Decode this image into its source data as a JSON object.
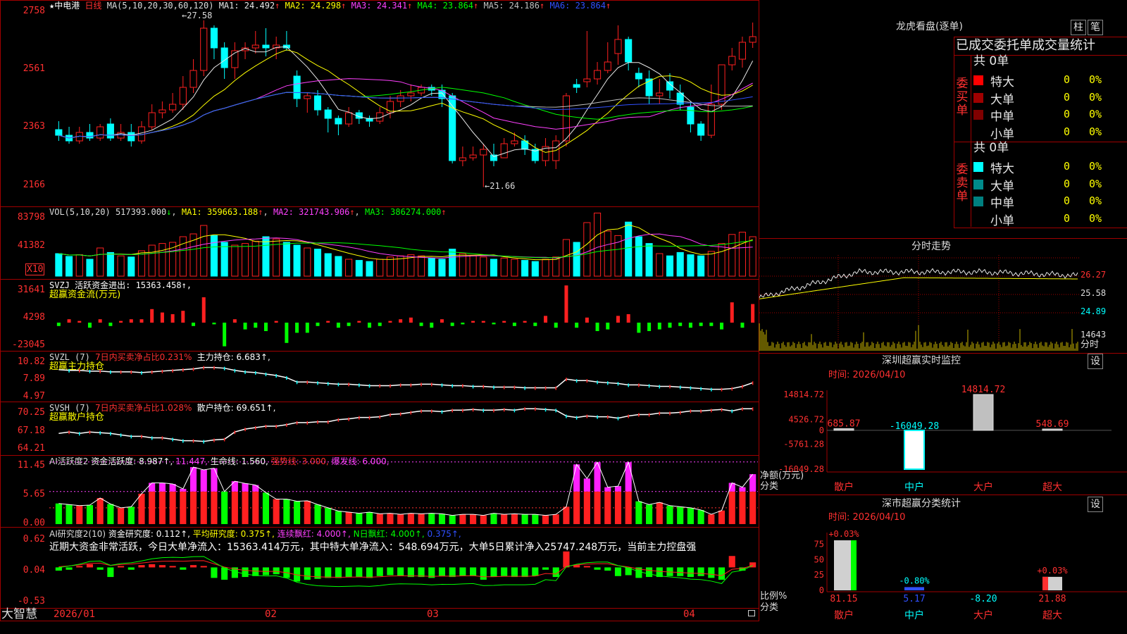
{
  "stock": {
    "star": "★",
    "name": "中电港",
    "period": "日线",
    "ma_title": "MA(5,10,20,30,60,120)",
    "ma": [
      {
        "label": "MA1: 24.492",
        "arrow": "↑",
        "color": "#e8e8e8"
      },
      {
        "label": "MA2: 24.298",
        "arrow": "↑",
        "color": "#ffff00"
      },
      {
        "label": "MA3: 24.341",
        "arrow": "↑",
        "color": "#ff40ff"
      },
      {
        "label": "MA4: 23.864",
        "arrow": "↑",
        "color": "#00ff00"
      },
      {
        "label": "MA5: 24.186",
        "arrow": "↑",
        "color": "#c0c0c0"
      },
      {
        "label": "MA6: 23.864",
        "arrow": "↑",
        "color": "#3050ff"
      }
    ],
    "high_mark": "←27.58",
    "low_mark": "←21.66"
  },
  "price_axis": [
    "2758",
    "2561",
    "2363",
    "2166"
  ],
  "vol": {
    "title": "VOL(5,10,20)",
    "value": "517393.000",
    "down": "↓",
    "ma1": "MA1: 359663.188",
    "ma2": "MA2: 321743.906",
    "ma3": "MA3: 386274.000",
    "up": "↑",
    "axis": [
      "83798",
      "41382"
    ],
    "unit": "X10"
  },
  "svzj": {
    "title": "SVZJ  活跃资金进出: 15363.458↑,",
    "subtitle": "超赢资金流(万元)",
    "axis": [
      "31641",
      "4298",
      "-23045"
    ]
  },
  "svzl": {
    "title": "SVZL (7)",
    "red": "7日内买卖净占比0.231%",
    "white": "主力持仓: 6.683↑,",
    "subtitle": "超赢主力持仓",
    "axis": [
      "10.82",
      "7.89",
      "4.97"
    ]
  },
  "svsh": {
    "title": "SVSH (7)",
    "red": "7日内买卖净占比1.028%",
    "white": "散户持仓: 69.651↑,",
    "subtitle": "超赢散户持仓",
    "axis": [
      "70.25",
      "67.18",
      "64.21"
    ]
  },
  "ai_act": {
    "title": "AI活跃度2",
    "a": "资金活跃度: 8.987↑,",
    "b": "11.447,",
    "c": "生命线: 1.560,",
    "d": "强势线: 3.000,",
    "e": "爆发线: 6.000,",
    "axis": [
      "11.45",
      "5.65",
      "0.00"
    ]
  },
  "ai_res": {
    "title": "AI研究度2(10)",
    "a": "资金研究度: 0.112↑,",
    "b": "平均研究度: 0.375↑,",
    "c": "连续飘红: 4.000↑,",
    "d": "N日飘红: 4.000↑,",
    "e": "0.375↑,",
    "note": "近期大资金非常活跃，今日大单净流入：15363.414万元，其中特大单净流入：548.694万元，大单5日累计净入25747.248万元，当前主力控盘强",
    "axis": [
      "0.62",
      "0.04",
      "-0.53"
    ]
  },
  "date_axis": [
    "2026/01",
    "02",
    "03",
    "04"
  ],
  "brand": "大智慧",
  "lhb": {
    "title": "龙虎看盘(逐单)",
    "btn1": "柱",
    "btn2": "笔",
    "tabs": "已成交委托单成交量统计",
    "buy_label": "委买单",
    "sell_label": "委卖单",
    "count": "共 0单",
    "rows": [
      {
        "name": "特大",
        "v": "0",
        "p": "0%"
      },
      {
        "name": "大单",
        "v": "0",
        "p": "0%"
      },
      {
        "name": "中单",
        "v": "0",
        "p": "0%"
      },
      {
        "name": "小单",
        "v": "0",
        "p": "0%"
      }
    ],
    "colors": {
      "buy": [
        "#ff0000",
        "#a00000",
        "#800000",
        "#000000"
      ],
      "sell": [
        "#00ffff",
        "#008b8b",
        "#008080",
        "#000000"
      ]
    }
  },
  "fenshi": {
    "title": "分时走势",
    "axis": [
      "26.27",
      "25.58",
      "24.89"
    ],
    "vol_label": "14643",
    "vol_unit": "分时"
  },
  "sz_rt": {
    "title": "深圳超赢实时监控",
    "btn": "设",
    "time": "时间: 2026/04/10",
    "axis": [
      "14814.72",
      "4526.72",
      "0",
      "-5761.28",
      "-16049.28"
    ],
    "ylabel": "净额(万元)",
    "xlabel": "分类",
    "cats": [
      "散户",
      "中户",
      "大户",
      "超大"
    ],
    "values": [
      685.87,
      -16049.28,
      14814.72,
      548.69
    ],
    "value_labels": [
      "685.87",
      "-16049.28",
      "14814.72",
      "548.69"
    ]
  },
  "sz_cls": {
    "title": "深市超赢分类统计",
    "btn": "设",
    "time": "时间: 2026/04/10",
    "axis": [
      "75",
      "50",
      "25",
      "0"
    ],
    "ylabel": "比例%",
    "xlabel": "分类",
    "cats": [
      "散户",
      "中户",
      "大户",
      "超大"
    ],
    "values": [
      81.15,
      5.17,
      -8.2,
      21.88
    ],
    "value_labels": [
      "81.15",
      "5.17",
      "-8.20",
      "21.88"
    ],
    "top_labels": [
      "+0.03%",
      "-0.80%",
      "",
      "+0.03%"
    ]
  },
  "chart_data": {
    "type": "candlestick",
    "candles": [
      [
        23.7,
        23.5,
        24.0,
        23.3
      ],
      [
        23.5,
        23.3,
        23.8,
        23.2
      ],
      [
        23.3,
        23.6,
        23.8,
        23.2
      ],
      [
        23.6,
        23.4,
        23.9,
        23.3
      ],
      [
        23.4,
        23.8,
        23.9,
        23.3
      ],
      [
        23.9,
        23.4,
        24.1,
        23.3
      ],
      [
        23.4,
        23.6,
        23.9,
        23.3
      ],
      [
        23.6,
        23.3,
        23.9,
        23.1
      ],
      [
        23.3,
        23.8,
        24.0,
        23.2
      ],
      [
        23.8,
        24.3,
        24.6,
        23.7
      ],
      [
        24.3,
        24.4,
        24.7,
        24.1
      ],
      [
        24.4,
        24.6,
        25.0,
        24.3
      ],
      [
        24.6,
        25.2,
        25.6,
        24.4
      ],
      [
        25.2,
        25.8,
        26.2,
        25.0
      ],
      [
        25.8,
        27.3,
        27.58,
        25.6
      ],
      [
        27.3,
        26.6,
        27.4,
        26.2
      ],
      [
        26.6,
        25.9,
        26.8,
        25.5
      ],
      [
        25.9,
        26.5,
        26.8,
        25.5
      ],
      [
        26.5,
        26.6,
        26.8,
        26.2
      ],
      [
        26.6,
        26.7,
        27.2,
        26.4
      ],
      [
        26.7,
        26.6,
        27.3,
        26.3
      ],
      [
        26.6,
        26.7,
        27.0,
        26.2
      ],
      [
        26.7,
        26.6,
        27.2,
        26.5
      ],
      [
        25.6,
        24.8,
        25.8,
        24.5
      ],
      [
        24.8,
        24.9,
        25.0,
        24.3
      ],
      [
        24.9,
        24.4,
        25.1,
        24.2
      ],
      [
        24.4,
        24.1,
        24.5,
        23.6
      ],
      [
        24.1,
        23.9,
        24.2,
        23.5
      ],
      [
        23.9,
        24.3,
        24.5,
        23.8
      ],
      [
        24.3,
        24.1,
        24.4,
        23.9
      ],
      [
        24.1,
        24.0,
        24.2,
        23.8
      ],
      [
        24.0,
        24.3,
        24.5,
        23.9
      ],
      [
        24.3,
        24.7,
        24.9,
        24.1
      ],
      [
        24.7,
        24.9,
        25.1,
        24.5
      ],
      [
        24.9,
        25.0,
        25.3,
        24.7
      ],
      [
        25.0,
        25.2,
        25.3,
        24.9
      ],
      [
        25.2,
        25.1,
        25.3,
        24.9
      ],
      [
        25.1,
        24.8,
        25.3,
        24.5
      ],
      [
        24.9,
        22.6,
        25.0,
        22.5
      ],
      [
        22.6,
        22.7,
        23.1,
        22.4
      ],
      [
        22.7,
        22.8,
        23.1,
        22.6
      ],
      [
        22.8,
        23.0,
        23.2,
        21.66
      ],
      [
        22.8,
        22.6,
        23.2,
        22.4
      ],
      [
        22.7,
        23.2,
        23.4,
        22.8
      ],
      [
        23.2,
        23.3,
        23.6,
        23.1
      ],
      [
        23.3,
        23.0,
        23.5,
        22.8
      ],
      [
        23.0,
        22.6,
        23.2,
        22.5
      ],
      [
        22.6,
        23.1,
        23.4,
        22.4
      ],
      [
        22.6,
        23.3,
        23.5,
        22.3
      ],
      [
        23.3,
        24.9,
        25.0,
        23.1
      ],
      [
        25.3,
        25.2,
        25.5,
        25.0
      ],
      [
        25.4,
        25.5,
        27.2,
        25.2
      ],
      [
        25.5,
        25.8,
        26.1,
        25.3
      ],
      [
        25.8,
        26.1,
        26.8,
        25.7
      ],
      [
        26.4,
        26.9,
        27.4,
        26.0
      ],
      [
        26.9,
        26.1,
        27.0,
        25.8
      ],
      [
        25.7,
        25.5,
        25.9,
        25.2
      ],
      [
        25.5,
        24.9,
        25.8,
        24.6
      ],
      [
        24.9,
        25.0,
        25.5,
        24.6
      ],
      [
        25.4,
        25.1,
        25.7,
        24.8
      ],
      [
        25.0,
        24.6,
        25.3,
        24.4
      ],
      [
        24.5,
        23.9,
        24.7,
        23.6
      ],
      [
        23.9,
        23.5,
        24.0,
        23.3
      ],
      [
        23.5,
        24.6,
        25.3,
        23.4
      ],
      [
        24.6,
        26.0,
        26.0,
        24.4
      ],
      [
        26.0,
        26.3,
        26.6,
        25.8
      ],
      [
        26.2,
        26.8,
        27.0,
        25.9
      ],
      [
        26.8,
        27.0,
        27.5,
        26.6
      ]
    ],
    "candle_ylim": [
      21.0,
      28.3
    ],
    "volume": [
      40,
      35,
      38,
      30,
      50,
      42,
      36,
      34,
      45,
      55,
      58,
      60,
      70,
      75,
      90,
      72,
      60,
      55,
      58,
      62,
      70,
      66,
      60,
      55,
      50,
      48,
      40,
      35,
      30,
      28,
      26,
      30,
      34,
      36,
      38,
      36,
      32,
      30,
      48,
      40,
      36,
      34,
      30,
      32,
      30,
      28,
      26,
      30,
      34,
      65,
      60,
      95,
      112,
      80,
      72,
      96,
      70,
      58,
      40,
      36,
      42,
      38,
      36,
      44,
      58,
      74,
      78,
      70
    ],
    "volume_ylim": [
      0,
      120000
    ],
    "svzj": [
      -2,
      2,
      1,
      -3,
      2,
      -2,
      1,
      2,
      2,
      8,
      6,
      5,
      7,
      -2,
      15,
      -1,
      -14,
      2,
      -4,
      -3,
      -5,
      1,
      -12,
      -6,
      -6,
      -2,
      1,
      -3,
      -2,
      1,
      -3,
      -2,
      1,
      2,
      3,
      -2,
      -3,
      2,
      -2,
      -1,
      1,
      1,
      -1,
      1,
      -2,
      1,
      -2,
      4,
      -3,
      22,
      -3,
      3,
      -5,
      -4,
      4,
      5,
      -6,
      -5,
      -4,
      -3,
      -2,
      -3,
      -2,
      -2,
      -4,
      12,
      -3,
      11
    ],
    "svzl": [
      8.6,
      8.5,
      8.5,
      8.4,
      8.4,
      8.3,
      8.3,
      8.3,
      8.2,
      8.3,
      8.4,
      8.5,
      8.6,
      8.7,
      8.9,
      8.9,
      8.8,
      8.5,
      8.3,
      8.2,
      8.0,
      7.8,
      7.5,
      6.9,
      6.9,
      6.8,
      6.7,
      6.6,
      6.6,
      6.5,
      6.4,
      6.4,
      6.4,
      6.5,
      6.5,
      6.6,
      6.6,
      6.5,
      6.4,
      6.4,
      6.3,
      6.3,
      6.2,
      6.2,
      6.2,
      6.1,
      6.1,
      6.1,
      6.1,
      7.3,
      7.1,
      7.1,
      6.9,
      6.8,
      6.7,
      6.5,
      6.5,
      6.4,
      6.3,
      6.3,
      6.2,
      6.1,
      6.0,
      5.9,
      5.9,
      6.0,
      6.3,
      6.8
    ],
    "svsh": [
      66.4,
      66.6,
      66.4,
      66.6,
      66.5,
      66.4,
      66.2,
      66.0,
      66.0,
      65.8,
      65.8,
      65.6,
      65.4,
      65.4,
      65.3,
      65.5,
      65.6,
      66.6,
      67.0,
      67.2,
      67.4,
      67.4,
      67.6,
      67.9,
      67.9,
      68.0,
      68.0,
      68.3,
      68.4,
      68.6,
      68.6,
      68.7,
      69.0,
      69.1,
      69.3,
      69.5,
      69.5,
      69.4,
      69.6,
      69.6,
      69.7,
      69.6,
      69.6,
      69.7,
      69.6,
      69.8,
      69.8,
      69.7,
      69.6,
      68.8,
      68.6,
      68.8,
      68.7,
      68.7,
      68.5,
      68.8,
      69.0,
      69.0,
      69.2,
      69.2,
      69.3,
      69.5,
      69.5,
      69.6,
      69.7,
      69.5,
      69.8,
      69.8
    ],
    "ai_act": [
      3.8,
      3.6,
      3.4,
      3.5,
      4.8,
      3.7,
      3.0,
      3.2,
      5.6,
      7.6,
      7.6,
      7.4,
      6.5,
      10.5,
      10.0,
      10.3,
      6.0,
      7.9,
      7.5,
      7.2,
      5.8,
      4.6,
      4.6,
      4.2,
      4.3,
      3.6,
      3.0,
      2.4,
      2.2,
      2.0,
      2.2,
      1.9,
      2.0,
      1.8,
      2.0,
      1.9,
      2.0,
      1.9,
      1.6,
      1.8,
      1.8,
      1.6,
      2.0,
      1.8,
      1.9,
      1.8,
      1.8,
      1.6,
      1.8,
      3.2,
      11.0,
      8.4,
      11.4,
      6.8,
      7.0,
      11.4,
      4.2,
      3.6,
      4.0,
      3.4,
      3.2,
      3.0,
      2.6,
      1.8,
      2.5,
      7.6,
      6.8,
      9.2
    ],
    "ai_act_ref": [
      1.56,
      3.0,
      6.0,
      11.447
    ],
    "ai_res": [
      0.02,
      0.03,
      0.04,
      0.06,
      0.03,
      -0.05,
      0.04,
      0.03,
      0.05,
      0.06,
      0.05,
      0.04,
      0.03,
      0.05,
      0.04,
      -0.06,
      -0.08,
      -0.06,
      -0.05,
      -0.04,
      -0.03,
      -0.02,
      -0.06,
      -0.1,
      -0.08,
      -0.07,
      -0.06,
      -0.06,
      -0.05,
      -0.05,
      -0.06,
      -0.04,
      -0.03,
      -0.04,
      -0.05,
      -0.05,
      -0.06,
      -0.04,
      -0.05,
      -0.04,
      -0.04,
      -0.08,
      -0.05,
      -0.04,
      -0.05,
      -0.05,
      -0.04,
      0.03,
      -0.05,
      0.2,
      0.05,
      0.04,
      0.03,
      0.02,
      -0.04,
      -0.03,
      -0.06,
      -0.05,
      -0.05,
      -0.04,
      -0.04,
      -0.05,
      -0.04,
      -0.06,
      -0.08,
      0.15,
      0.02,
      0.08
    ],
    "ai_res_ylim": [
      -0.53,
      0.62
    ],
    "intraday_ylim": [
      24.2,
      26.6
    ]
  }
}
